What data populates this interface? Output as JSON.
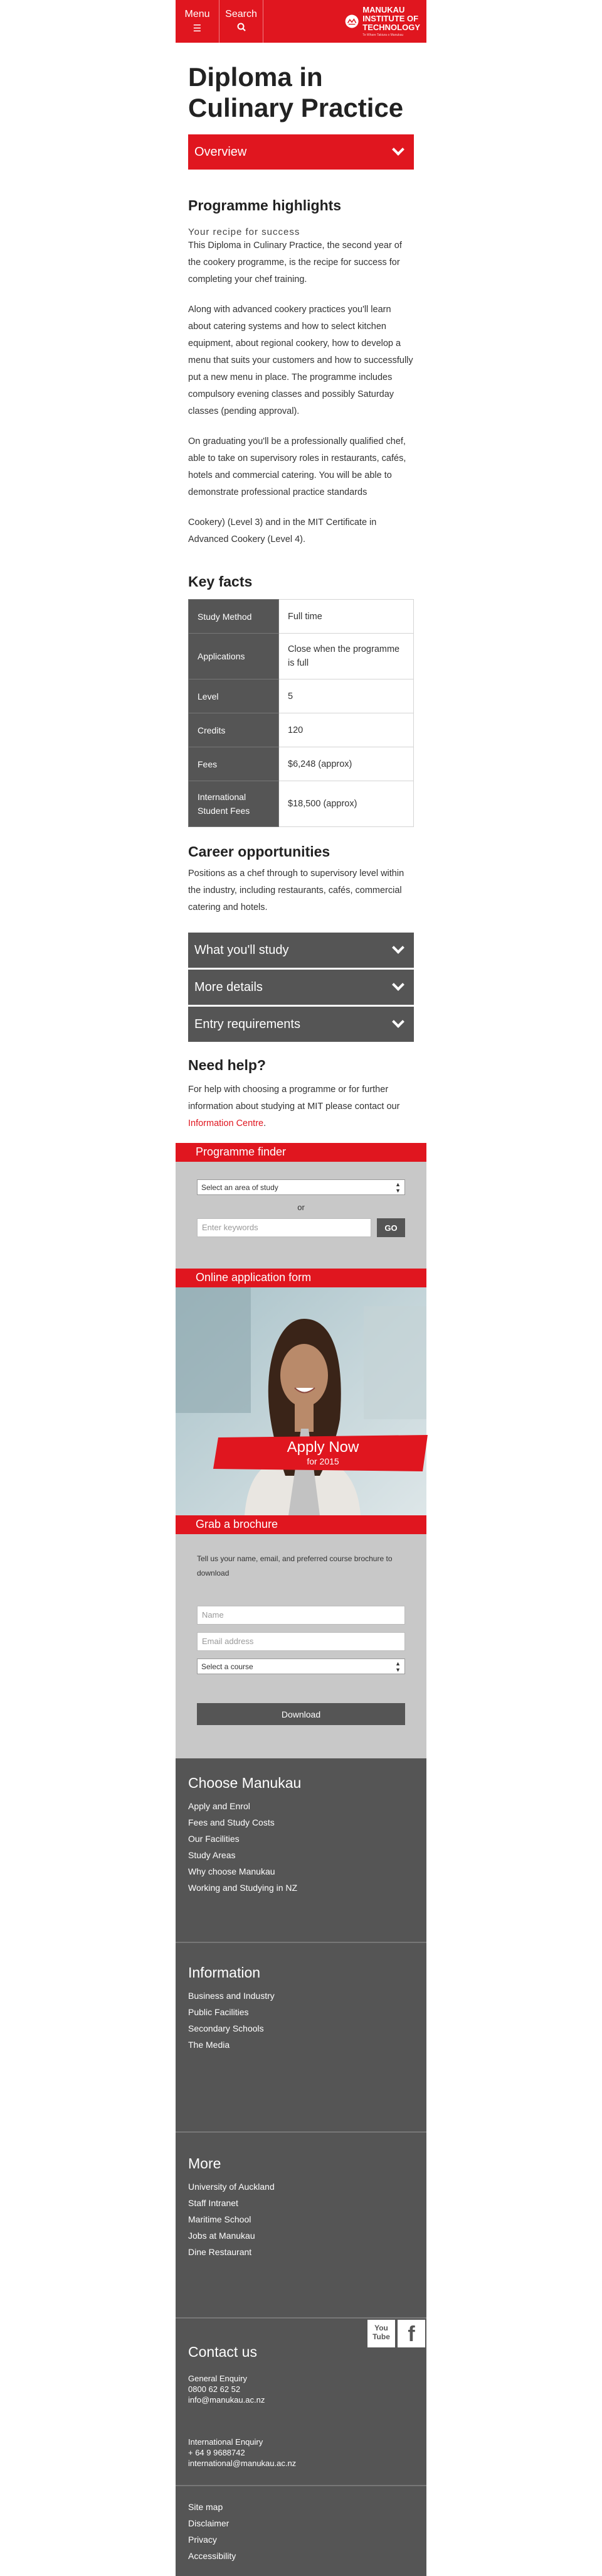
{
  "header": {
    "menu_label": "Menu",
    "menu_icon": "☰",
    "search_label": "Search",
    "search_icon": "⌕",
    "logo_line1": "MANUKAU",
    "logo_line2": "INSTITUTE OF",
    "logo_line3": "TECHNOLOGY",
    "logo_tagline": "Te Whare Takiura o Manukau"
  },
  "page": {
    "title": "Diploma in Culinary Practice",
    "overview_label": "Overview",
    "highlights_heading": "Programme highlights",
    "highlights_sub": "Your recipe for success",
    "paragraph1": "This Diploma in Culinary Practice, the second year of the cookery programme, is the recipe for success for completing your chef training.",
    "paragraph2": "Along with advanced cookery practices you'll learn about catering systems and how to select kitchen equipment, about regional cookery, how to develop a menu that suits your customers and how to successfully put a new menu in place. The programme includes compulsory evening classes and possibly Saturday classes (pending approval).",
    "paragraph3": "On graduating you'll be a professionally qualified chef, able to take on supervisory roles in restaurants, cafés, hotels and commercial catering. You will be able to demonstrate professional practice standards",
    "paragraph4": "Cookery) (Level 3) and in the MIT Certificate in Advanced Cookery (Level 4).",
    "keyfacts_heading": "Key facts",
    "keyfacts": [
      {
        "label": "Study Method",
        "value": "Full time"
      },
      {
        "label": "Applications",
        "value": "Close when the programme is full"
      },
      {
        "label": "Level",
        "value": "5"
      },
      {
        "label": "Credits",
        "value": "120"
      },
      {
        "label": "Fees",
        "value": "$6,248 (approx)"
      },
      {
        "label": "International Student Fees",
        "value": "$18,500 (approx)"
      }
    ],
    "career_heading": "Career opportunities",
    "career_text": "Positions as a chef through to supervisory level within the industry, including restaurants, cafés, commercial catering and hotels.",
    "accordions": [
      "What you'll study",
      "More details",
      "Entry requirements"
    ],
    "help_heading": "Need help?",
    "help_text": "For help with choosing a programme or for further information about studying at MIT please contact our",
    "help_link": "Information Centre",
    "help_end": "."
  },
  "finder": {
    "title": "Programme finder",
    "select_placeholder": "Select an area of study",
    "or_label": "or",
    "keyword_placeholder": "Enter keywords",
    "go_label": "GO"
  },
  "application": {
    "title": "Online application form",
    "apply_label": "Apply Now",
    "apply_year": "for 2015"
  },
  "brochure": {
    "title": "Grab a brochure",
    "intro": "Tell us your name, email, and preferred course brochure to download",
    "name_placeholder": "Name",
    "email_placeholder": "Email address",
    "course_placeholder": "Select a course",
    "download_label": "Download"
  },
  "footer": {
    "choose_heading": "Choose Manukau",
    "choose_links": [
      "Apply and Enrol",
      "Fees and Study Costs",
      "Our Facilities",
      "Study Areas",
      "Why choose Manukau",
      "Working and Studying in NZ"
    ],
    "info_heading": "Information",
    "info_links": [
      "Business and Industry",
      "Public Facilities",
      "Secondary Schools",
      "The Media"
    ],
    "more_heading": "More",
    "more_links": [
      "University of Auckland",
      "Staff Intranet",
      "Maritime School",
      "Jobs at Manukau",
      "Dine Restaurant"
    ],
    "social_youtube": "You Tube",
    "social_facebook": "f",
    "contact_heading": "Contact us",
    "general_label": "General Enquiry",
    "general_phone": "0800 62 62 52",
    "general_email": "info@manukau.ac.nz",
    "intl_label": "International Enquiry",
    "intl_phone": "+ 64 9 9688742",
    "intl_email": "international@manukau.ac.nz",
    "bottom_links": [
      "Site map",
      "Disclaimer",
      "Privacy",
      "Accessibility"
    ]
  },
  "colors": {
    "brand_red": "#e0161f",
    "dark_grey": "#555555",
    "panel_grey": "#c8c8c8"
  }
}
